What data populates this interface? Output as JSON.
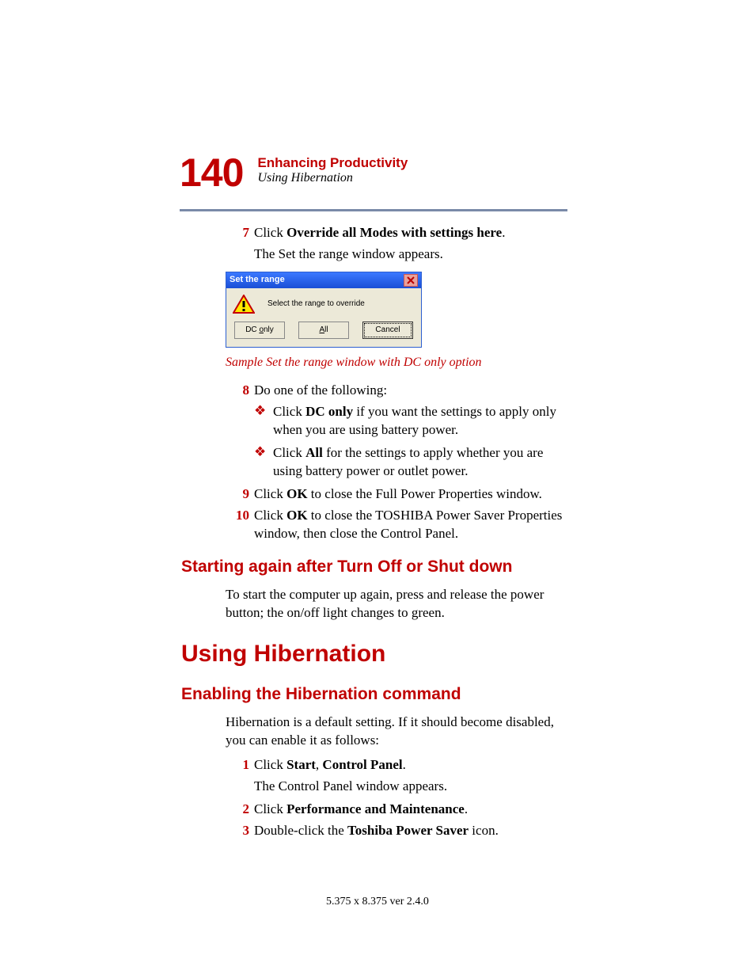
{
  "header": {
    "page_number": "140",
    "chapter": "Enhancing Productivity",
    "section": "Using Hibernation"
  },
  "steps_a": {
    "s7_text_pre": "Click ",
    "s7_bold": "Override all Modes with settings here",
    "s7_text_post": ".",
    "s7_follow": "The Set the range window appears."
  },
  "dialog": {
    "title": "Set the range",
    "message": "Select the range to override",
    "btn_dc_full": "DC only",
    "btn_all_full": "All",
    "btn_cancel": "Cancel"
  },
  "caption": "Sample Set the range window with DC only option",
  "steps_b": {
    "s8_text": "Do one of the following:",
    "b1_pre": "Click ",
    "b1_bold": "DC only",
    "b1_post": " if you want the settings to apply only when you are using battery power.",
    "b2_pre": "Click ",
    "b2_bold": "All",
    "b2_post": " for the settings to apply whether you are using battery power or outlet power.",
    "s9_pre": "Click ",
    "s9_bold": "OK",
    "s9_post": " to close the Full Power Properties window.",
    "s10_pre": "Click ",
    "s10_bold": "OK",
    "s10_post": " to close the TOSHIBA Power Saver Properties window, then close the Control Panel."
  },
  "h2a": "Starting again after Turn Off or Shut down",
  "para_a": "To start the computer up again, press and release the power button; the on/off light changes to green.",
  "h1a": "Using Hibernation",
  "h2b": "Enabling the Hibernation command",
  "para_b": "Hibernation is a default setting. If it should become disabled, you can enable it as follows:",
  "steps_c": {
    "s1_pre": "Click ",
    "s1_b1": "Start",
    "s1_mid": ", ",
    "s1_b2": "Control Panel",
    "s1_post": ".",
    "s1_follow": "The Control Panel window appears.",
    "s2_pre": "Click ",
    "s2_bold": "Performance and Maintenance",
    "s2_post": ".",
    "s3_pre": "Double-click the ",
    "s3_bold": "Toshiba Power Saver",
    "s3_post": " icon."
  },
  "nums": {
    "n7": "7",
    "n8": "8",
    "n9": "9",
    "n10": "10",
    "n1": "1",
    "n2": "2",
    "n3": "3"
  },
  "footer": "5.375 x 8.375 ver 2.4.0"
}
